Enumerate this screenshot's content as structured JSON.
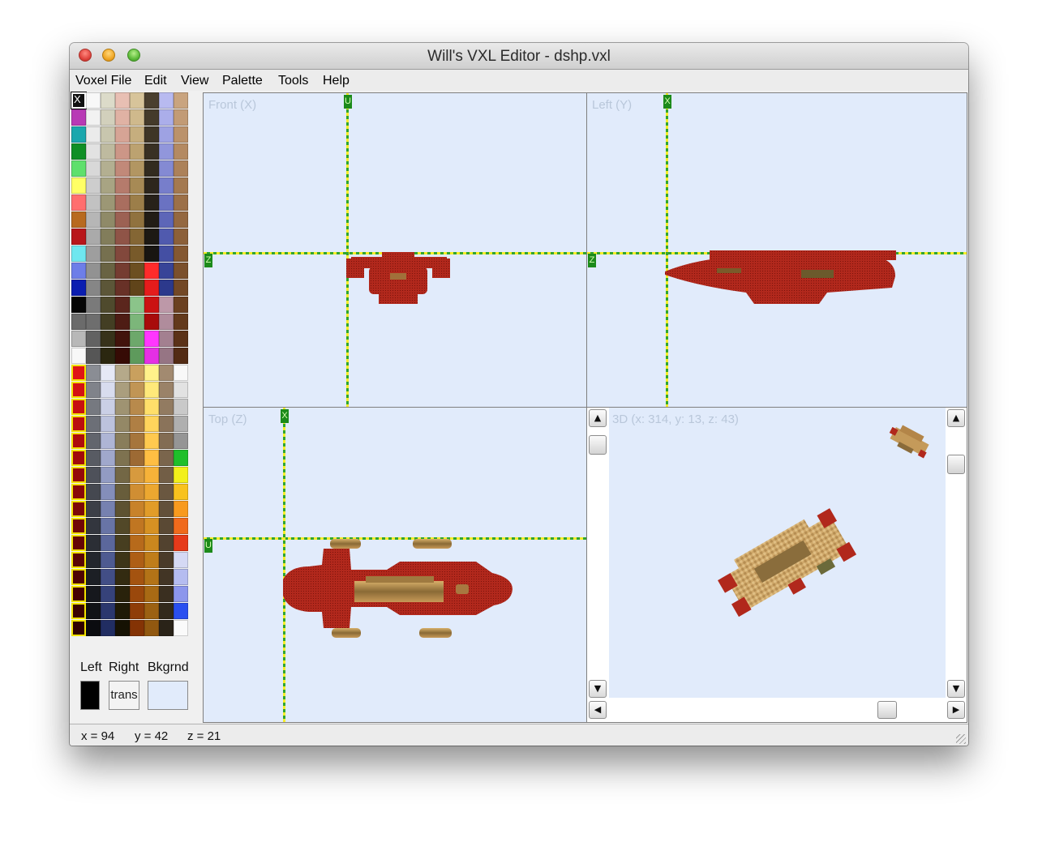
{
  "window": {
    "title": "Will's VXL Editor - dshp.vxl"
  },
  "menu": [
    {
      "label": "Voxel File"
    },
    {
      "label": "Edit"
    },
    {
      "label": "View"
    },
    {
      "label": "Palette"
    },
    {
      "label": "Tools"
    },
    {
      "label": "Help"
    }
  ],
  "palette": {
    "selected_marker": "X",
    "columns": [
      [
        "#111111",
        "#b83ab5",
        "#1aa7ad",
        "#0f8f25",
        "#5fe06c",
        "#ffff66",
        "#ff6e6e",
        "#b86a1f",
        "#b8161a",
        "#6fe7ef",
        "#6d7ee8",
        "#0b1eb0",
        "#050505",
        "#6b6b6b",
        "#b8b8b8",
        "#f8f8f8",
        "#e01515",
        "#d41212",
        "#c71010",
        "#bb0e0e",
        "#ae0c0c",
        "#a20a0a",
        "#950909",
        "#890808",
        "#7d0707",
        "#710606",
        "#650505",
        "#5a0404",
        "#4f0303",
        "#440202",
        "#3a0101",
        "#300000"
      ],
      [
        "#f8f8f8",
        "#f2f2f2",
        "#ebebeb",
        "#e2e2e2",
        "#d8d8d8",
        "#cdcdcd",
        "#c2c2c2",
        "#b6b6b6",
        "#aaaaaa",
        "#9e9e9e",
        "#929292",
        "#868686",
        "#7a7a7a",
        "#6e6e6e",
        "#626262",
        "#565656",
        "#8a8d94",
        "#80838a",
        "#767980",
        "#6c6f77",
        "#62656d",
        "#585b63",
        "#4e515a",
        "#454850",
        "#3c3f47",
        "#33363e",
        "#2b2e35",
        "#23262d",
        "#1c1f25",
        "#16181d",
        "#101216",
        "#0b0c10"
      ],
      [
        "#dcdbc9",
        "#d2d0bc",
        "#c8c6ae",
        "#beba9f",
        "#b3af91",
        "#a8a483",
        "#9c9775",
        "#8f8a68",
        "#827d5b",
        "#76704f",
        "#696343",
        "#5c5638",
        "#4f4a2d",
        "#433e23",
        "#37321a",
        "#2b2710",
        "#e6e9f6",
        "#d8dcee",
        "#cacfe6",
        "#bcc2dd",
        "#aeb5d5",
        "#a0a8cc",
        "#929bc3",
        "#848eba",
        "#7681b0",
        "#6874a6",
        "#5b679c",
        "#4e5a91",
        "#424e86",
        "#36427a",
        "#2b376e",
        "#212d62"
      ],
      [
        "#e8bfb3",
        "#e0b2a4",
        "#d6a495",
        "#cc9687",
        "#c18979",
        "#b57b6c",
        "#a96e5f",
        "#9c6153",
        "#8f5447",
        "#82483c",
        "#753c31",
        "#683127",
        "#5b261d",
        "#4e1c14",
        "#42130c",
        "#360b05",
        "#b5a98a",
        "#aa9e7e",
        "#9f9372",
        "#948866",
        "#897d5b",
        "#7e7250",
        "#736745",
        "#685d3b",
        "#5d5231",
        "#524828",
        "#473e20",
        "#3d3418",
        "#332b11",
        "#29220b",
        "#1f1a06",
        "#161203"
      ],
      [
        "#d7c49a",
        "#cfb98c",
        "#c6ae7e",
        "#bca270",
        "#b29662",
        "#a78a55",
        "#9c7e49",
        "#90723e",
        "#846634",
        "#785a2a",
        "#6c4f21",
        "#60441a",
        "#8bc48a",
        "#7cb67a",
        "#6da86b",
        "#5e9a5c",
        "#c9a05e",
        "#c19555",
        "#b88a4c",
        "#af7f44",
        "#a6753c",
        "#9d6a34",
        "#d79a3e",
        "#d08e33",
        "#c8822a",
        "#c07622",
        "#b76a1b",
        "#ae5e15",
        "#a45310",
        "#9a480c",
        "#8f3d08",
        "#843305"
      ],
      [
        "#4a3f2e",
        "#443a2a",
        "#3e3526",
        "#383023",
        "#322b1f",
        "#2d261c",
        "#272119",
        "#221d16",
        "#1d1913",
        "#181511",
        "#ff2b2b",
        "#e51c1c",
        "#cb1212",
        "#a80b0b",
        "#ff36ff",
        "#e52fe5",
        "#fff28a",
        "#ffe97a",
        "#ffdf6a",
        "#ffd45c",
        "#ffc94f",
        "#ffbe43",
        "#f6b239",
        "#eca730",
        "#e19c29",
        "#d69123",
        "#ca871e",
        "#bf7d1a",
        "#b37317",
        "#a86a14",
        "#9c6112",
        "#915810"
      ],
      [
        "#b8baf0",
        "#abaeea",
        "#9ea2e3",
        "#9196db",
        "#848ad3",
        "#777ecb",
        "#6a72c2",
        "#5d66b8",
        "#505aae",
        "#444fa3",
        "#384498",
        "#2c398c",
        "#bd98a8",
        "#b08c9c",
        "#a38090",
        "#967584",
        "#a28a70",
        "#9a8268",
        "#927b61",
        "#8a735a",
        "#826c53",
        "#7a654c",
        "#725e46",
        "#6a5740",
        "#62503a",
        "#5a4934",
        "#52422f",
        "#4a3b2a",
        "#423525",
        "#3a2f20",
        "#32291c",
        "#2a2318"
      ],
      [
        "#c9a47f",
        "#c29b75",
        "#bb926b",
        "#b48a62",
        "#ac8159",
        "#a47950",
        "#9c7048",
        "#946840",
        "#8c6039",
        "#845832",
        "#7b502c",
        "#734826",
        "#6b4021",
        "#63391c",
        "#5b3218",
        "#532b14",
        "#f8f8f8",
        "#e2e2e2",
        "#c9c9c9",
        "#afafaf",
        "#959595",
        "#1fbf2a",
        "#f2f01a",
        "#f8c21e",
        "#f89a1e",
        "#f06a1c",
        "#e63a1a",
        "#d5d9f4",
        "#b5bcf0",
        "#8c96ec",
        "#2a4ff0",
        "#fafafa"
      ]
    ]
  },
  "colors": {
    "left": "#000000",
    "right_label": "trans",
    "background": "#e1ebfb"
  },
  "color_labels": {
    "left": "Left",
    "right": "Right",
    "bkgrnd": "Bkgrnd"
  },
  "views": {
    "front": {
      "label": "Front (X)",
      "v_marker": "U",
      "h_marker": "Z"
    },
    "left": {
      "label": "Left (Y)",
      "v_marker": "X",
      "h_marker": "Z"
    },
    "top": {
      "label": "Top (Z)",
      "v_marker": "X",
      "h_marker": "U"
    },
    "three_d": {
      "label": "3D (x: 314, y: 13, z: 43)"
    }
  },
  "status": {
    "x": "x = 94",
    "y": "y = 42",
    "z": "z = 21"
  }
}
